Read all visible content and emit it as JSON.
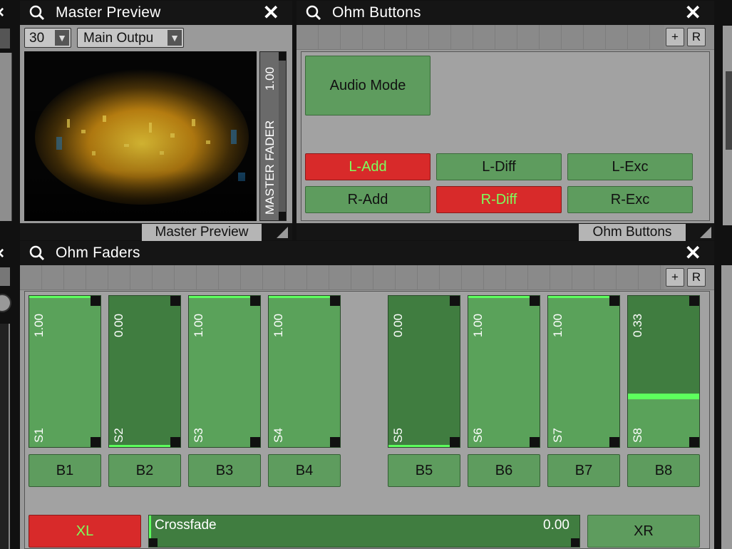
{
  "master_preview": {
    "title": "Master Preview",
    "fps_value": "30",
    "output_select": "Main Outpu",
    "fader_label": "MASTER FADER",
    "fader_value": "1.00",
    "fader_level": 1.0,
    "tab_label": "Master Preview"
  },
  "ohm_buttons": {
    "title": "Ohm Buttons",
    "add_label": "+",
    "reset_label": "R",
    "audio_mode_label": "Audio Mode",
    "buttons": [
      {
        "label": "L-Add",
        "active": true
      },
      {
        "label": "L-Diff",
        "active": false
      },
      {
        "label": "L-Exc",
        "active": false
      },
      {
        "label": "R-Add",
        "active": false
      },
      {
        "label": "R-Diff",
        "active": true
      },
      {
        "label": "R-Exc",
        "active": false
      }
    ],
    "tab_label": "Ohm Buttons"
  },
  "ohm_faders": {
    "title": "Ohm Faders",
    "add_label": "+",
    "reset_label": "R",
    "faders": [
      {
        "label": "S1",
        "value": "1.00",
        "level": 1.0
      },
      {
        "label": "S2",
        "value": "0.00",
        "level": 0.0
      },
      {
        "label": "S3",
        "value": "1.00",
        "level": 1.0
      },
      {
        "label": "S4",
        "value": "1.00",
        "level": 1.0
      },
      {
        "label": "S5",
        "value": "0.00",
        "level": 0.0
      },
      {
        "label": "S6",
        "value": "1.00",
        "level": 1.0
      },
      {
        "label": "S7",
        "value": "1.00",
        "level": 1.0
      },
      {
        "label": "S8",
        "value": "0.33",
        "level": 0.33
      }
    ],
    "buttons": [
      "B1",
      "B2",
      "B3",
      "B4",
      "B5",
      "B6",
      "B7",
      "B8"
    ],
    "xl_label": "XL",
    "xr_label": "XR",
    "crossfade_label": "Crossfade",
    "crossfade_value": "0.00",
    "crossfade_level": 0.0
  },
  "colors": {
    "active_red": "#d82a2a",
    "button_green": "#5e9c5e",
    "active_text_green": "#7dff5d"
  }
}
